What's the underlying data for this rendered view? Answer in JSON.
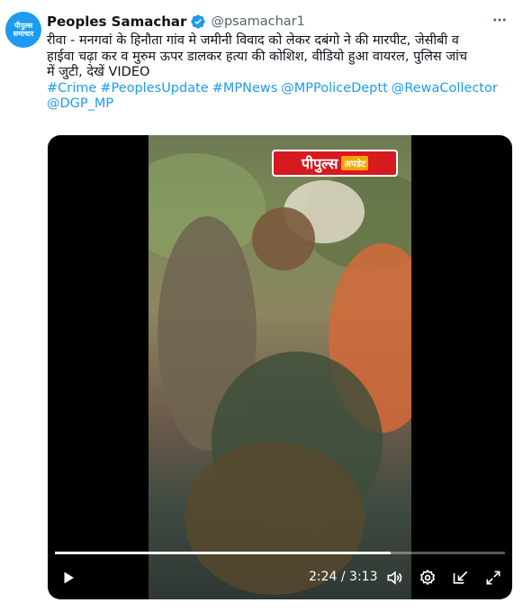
{
  "account": {
    "display_name": "Peoples Samachar",
    "handle": "@psamachar1",
    "avatar_text_line1": "पीपुल्स",
    "avatar_text_line2": "समाचार",
    "brand_color": "#1d9bf0"
  },
  "tweet": {
    "text_line1": "रीवा - मनगवां के हिनौता गांव मे जमीनी विवाद को लेकर दबंगो ने की मारपीट, जेसीबी व",
    "text_line2": "हाईवा चढ़ा कर  व मुरुम ऊपर डालकर हत्या की कोशिश, वीडियो हुआ वायरल, पुलिस जांच",
    "text_line3": "में जुटी, देखें VIDEO",
    "hashtags": [
      "#Crime",
      "#PeoplesUpdate",
      "#MPNews",
      "@MPPoliceDeptt",
      "@RewaCollector",
      "@DGP_MP"
    ]
  },
  "video": {
    "watermark_main": "पीपुल्स",
    "watermark_sub": "अपडेट",
    "current_time": "2:24",
    "duration": "3:13",
    "time_display": "2:24 / 3:13",
    "progress": 0.746,
    "icons": [
      "play-icon",
      "volume-icon",
      "settings-icon",
      "dock-icon",
      "fullscreen-icon"
    ]
  },
  "icons": {
    "verified": "verified-badge-icon",
    "more": "more-dots-icon"
  }
}
